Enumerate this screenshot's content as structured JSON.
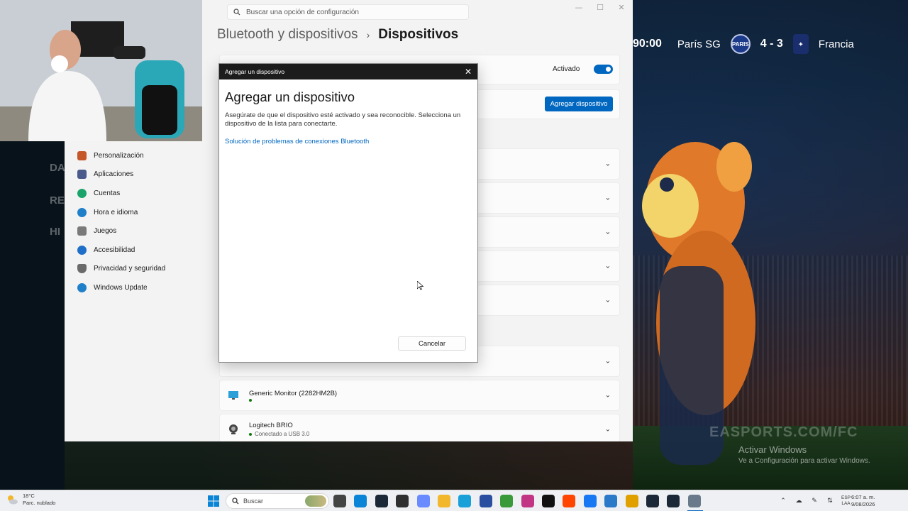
{
  "background": {
    "scoreboard": {
      "time": "90:00",
      "home_team": "París SG",
      "home_crest_text": "PARIS",
      "score": "4 - 3",
      "away_team": "Francia"
    },
    "ghost_labels": [
      "DA",
      "RE",
      "HI"
    ],
    "watermark": "EASPORTS.COM/FC",
    "activate_title": "Activar Windows",
    "activate_subtitle": "Ve a Configuración para activar Windows."
  },
  "settings": {
    "search_placeholder": "Buscar una opción de configuración",
    "breadcrumb_parent": "Bluetooth y dispositivos",
    "breadcrumb_separator": "›",
    "breadcrumb_current": "Dispositivos",
    "bluetooth_toggle_label": "Activado",
    "add_device_button": "Agregar dispositivo",
    "nav": [
      {
        "label": "Personalización",
        "icon": "brush-icon",
        "color": "#c4562a"
      },
      {
        "label": "Aplicaciones",
        "icon": "apps-icon",
        "color": "#4a5a8a"
      },
      {
        "label": "Cuentas",
        "icon": "person-icon",
        "color": "#1aa36b"
      },
      {
        "label": "Hora e idioma",
        "icon": "globe-clock-icon",
        "color": "#1f7fc9"
      },
      {
        "label": "Juegos",
        "icon": "controller-icon",
        "color": "#7a7a7a"
      },
      {
        "label": "Accesibilidad",
        "icon": "accessibility-icon",
        "color": "#1f6fc9"
      },
      {
        "label": "Privacidad y seguridad",
        "icon": "shield-icon",
        "color": "#6a6a6a"
      },
      {
        "label": "Windows Update",
        "icon": "update-icon",
        "color": "#1f7fc9"
      }
    ],
    "devices": [
      {
        "name": "Generic Monitor (2282HM2B)",
        "status": "",
        "icon": "monitor-icon"
      },
      {
        "name": "Logitech BRIO",
        "status": "Conectado a USB 3.0",
        "icon": "webcam-icon"
      }
    ]
  },
  "dialog": {
    "titlebar": "Agregar un dispositivo",
    "heading": "Agregar un dispositivo",
    "description": "Asegúrate de que el dispositivo esté activado y sea reconocible. Selecciona un dispositivo de la lista para conectarte.",
    "link": "Solución de problemas de conexiones Bluetooth",
    "cancel": "Cancelar"
  },
  "taskbar": {
    "weather_temp": "18°C",
    "weather_desc": "Parc. nublado",
    "search_label": "Buscar",
    "lang_line1": "ESP",
    "lang_line2": "LAA",
    "time": "6:07 a. m.",
    "date": "9/08/2026",
    "apps": [
      {
        "icon": "file-explorer-icon",
        "color": "#444"
      },
      {
        "icon": "store-icon",
        "color": "#0a84d6"
      },
      {
        "icon": "steam-icon",
        "color": "#1b2838"
      },
      {
        "icon": "obs-icon",
        "color": "#303030"
      },
      {
        "icon": "copilot-icon",
        "color": "#6a8bff"
      },
      {
        "icon": "folder-icon",
        "color": "#f2b72c"
      },
      {
        "icon": "edge-icon",
        "color": "#1aa0d8"
      },
      {
        "icon": "calculator-icon",
        "color": "#2a4ea0"
      },
      {
        "icon": "chrome-icon",
        "color": "#3a9a3a"
      },
      {
        "icon": "instagram-icon",
        "color": "#c13584"
      },
      {
        "icon": "x-icon",
        "color": "#111"
      },
      {
        "icon": "reddit-icon",
        "color": "#ff4500"
      },
      {
        "icon": "facebook-icon",
        "color": "#1877f2"
      },
      {
        "icon": "photos-icon",
        "color": "#2a7ac9"
      },
      {
        "icon": "rockstar-icon",
        "color": "#e0a000"
      },
      {
        "icon": "steam2-icon",
        "color": "#1b2838"
      },
      {
        "icon": "ea-icon",
        "color": "#1b2838"
      },
      {
        "icon": "settings-gear-icon",
        "color": "#6a7a8a"
      }
    ]
  }
}
